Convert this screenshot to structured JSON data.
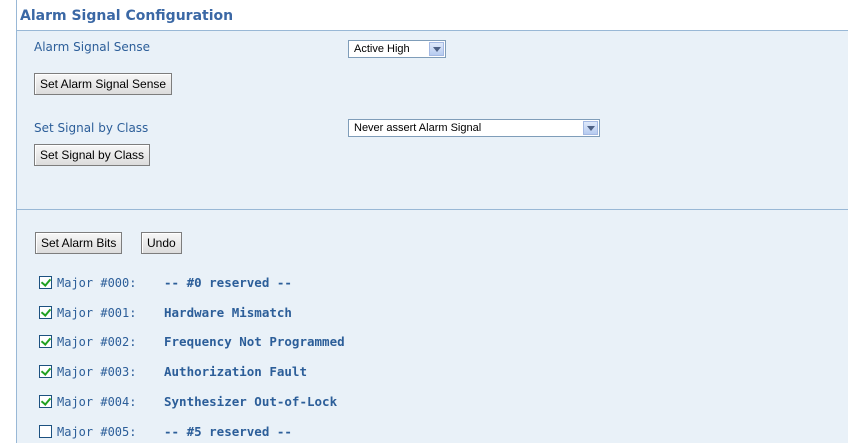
{
  "panel": {
    "title": "Alarm Signal Configuration"
  },
  "sense": {
    "label": "Alarm Signal Sense",
    "selected": "Active High",
    "button": "Set Alarm Signal Sense"
  },
  "byclass": {
    "label": "Set Signal by Class",
    "selected": "Never assert Alarm Signal",
    "button": "Set Signal by Class"
  },
  "actions": {
    "set_bits": "Set Alarm Bits",
    "undo": "Undo"
  },
  "alarms": [
    {
      "num": "Major #000:",
      "desc": "-- #0 reserved --",
      "checked": true
    },
    {
      "num": "Major #001:",
      "desc": "Hardware Mismatch",
      "checked": true
    },
    {
      "num": "Major #002:",
      "desc": "Frequency Not Programmed",
      "checked": true
    },
    {
      "num": "Major #003:",
      "desc": "Authorization Fault",
      "checked": true
    },
    {
      "num": "Major #004:",
      "desc": "Synthesizer Out-of-Lock",
      "checked": true
    },
    {
      "num": "Major #005:",
      "desc": "-- #5 reserved --",
      "checked": false
    }
  ]
}
